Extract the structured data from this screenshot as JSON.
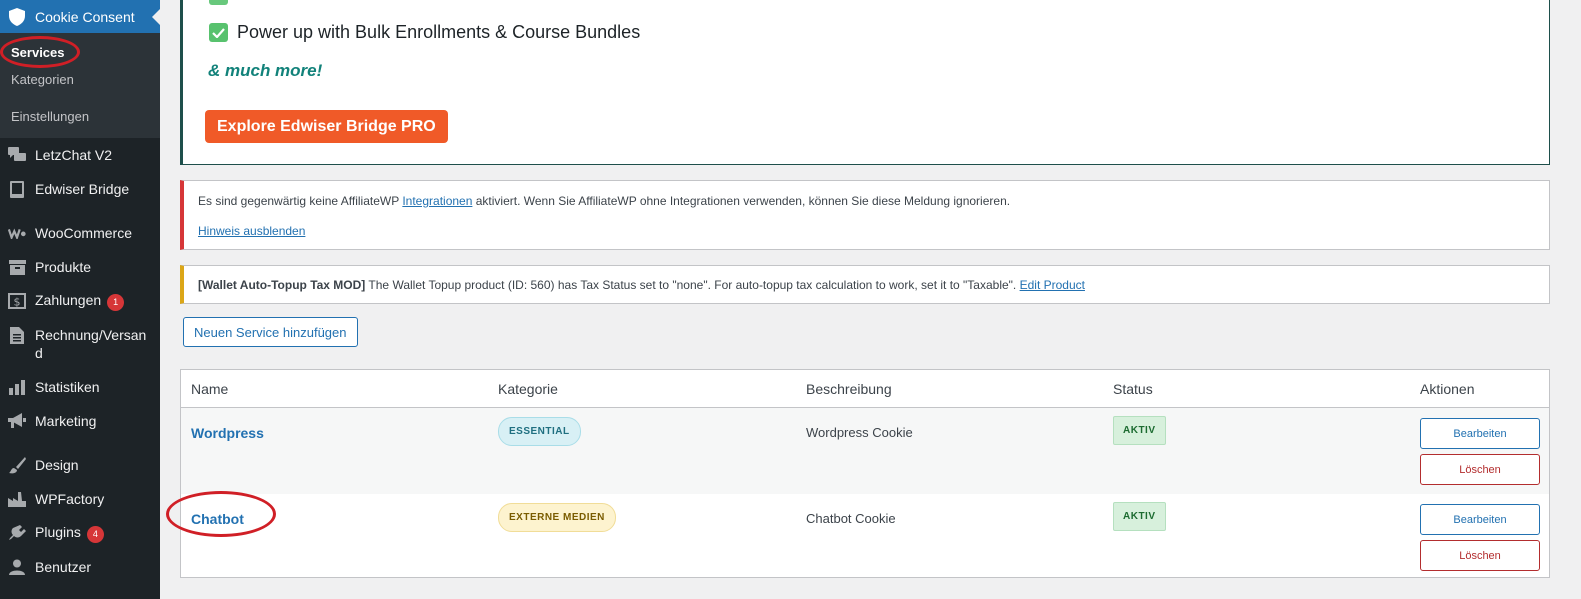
{
  "sidebar": {
    "current": {
      "label": "Cookie Consent",
      "icon": "shield-icon"
    },
    "submenu": [
      {
        "label": "Services",
        "active": true
      },
      {
        "label": "Kategorien",
        "active": false
      },
      {
        "label": "Einstellungen",
        "active": false
      }
    ],
    "items": [
      {
        "label": "LetzChat V2",
        "icon": "chat-bubbles-icon"
      },
      {
        "label": "Edwiser Bridge",
        "icon": "book-icon"
      },
      {
        "label": "WooCommerce",
        "icon": "woocommerce-icon"
      },
      {
        "label": "Produkte",
        "icon": "archive-box-icon"
      },
      {
        "label": "Zahlungen",
        "icon": "dollar-icon",
        "badge": "1"
      },
      {
        "label": "Rechnung/Versand",
        "icon": "document-icon"
      },
      {
        "label": "Statistiken",
        "icon": "bar-chart-icon"
      },
      {
        "label": "Marketing",
        "icon": "megaphone-icon"
      },
      {
        "label": "Design",
        "icon": "paintbrush-icon"
      },
      {
        "label": "WPFactory",
        "icon": "factory-icon"
      },
      {
        "label": "Plugins",
        "icon": "plug-icon",
        "badge": "4"
      },
      {
        "label": "Benutzer",
        "icon": "user-icon"
      }
    ]
  },
  "promo": {
    "feature": "Power up with Bulk Enrollments & Course Bundles",
    "more": "& much more!",
    "button": "Explore Edwiser Bridge PRO"
  },
  "notice_affiliate": {
    "text_before": "Es sind gegenwärtig keine AffiliateWP ",
    "link": "Integrationen",
    "text_after": " aktiviert. Wenn Sie AffiliateWP ohne Integrationen verwenden, können Sie diese Meldung ignorieren.",
    "dismiss": "Hinweis ausblenden"
  },
  "notice_wallet": {
    "tag": "[Wallet Auto-Topup Tax MOD]",
    "text": " The Wallet Topup product (ID: 560) has Tax Status set to \"none\". For auto-topup tax calculation to work, set it to \"Taxable\". ",
    "link": "Edit Product"
  },
  "add_service_button": "Neuen Service hinzufügen",
  "table": {
    "headers": {
      "name": "Name",
      "category": "Kategorie",
      "description": "Beschreibung",
      "status": "Status",
      "actions": "Aktionen"
    },
    "edit_label": "Bearbeiten",
    "delete_label": "Löschen",
    "rows": [
      {
        "name": "Wordpress",
        "category": "ESSENTIAL",
        "description": "Wordpress Cookie",
        "status": "AKTIV"
      },
      {
        "name": "Chatbot",
        "category": "EXTERNE MEDIEN",
        "description": "Chatbot Cookie",
        "status": "AKTIV"
      }
    ]
  },
  "colors": {
    "sidebar_bg": "#1d2327",
    "wp_blue": "#2271b1",
    "promo_orange": "#f05a28",
    "annotation_red": "#d01f26"
  }
}
